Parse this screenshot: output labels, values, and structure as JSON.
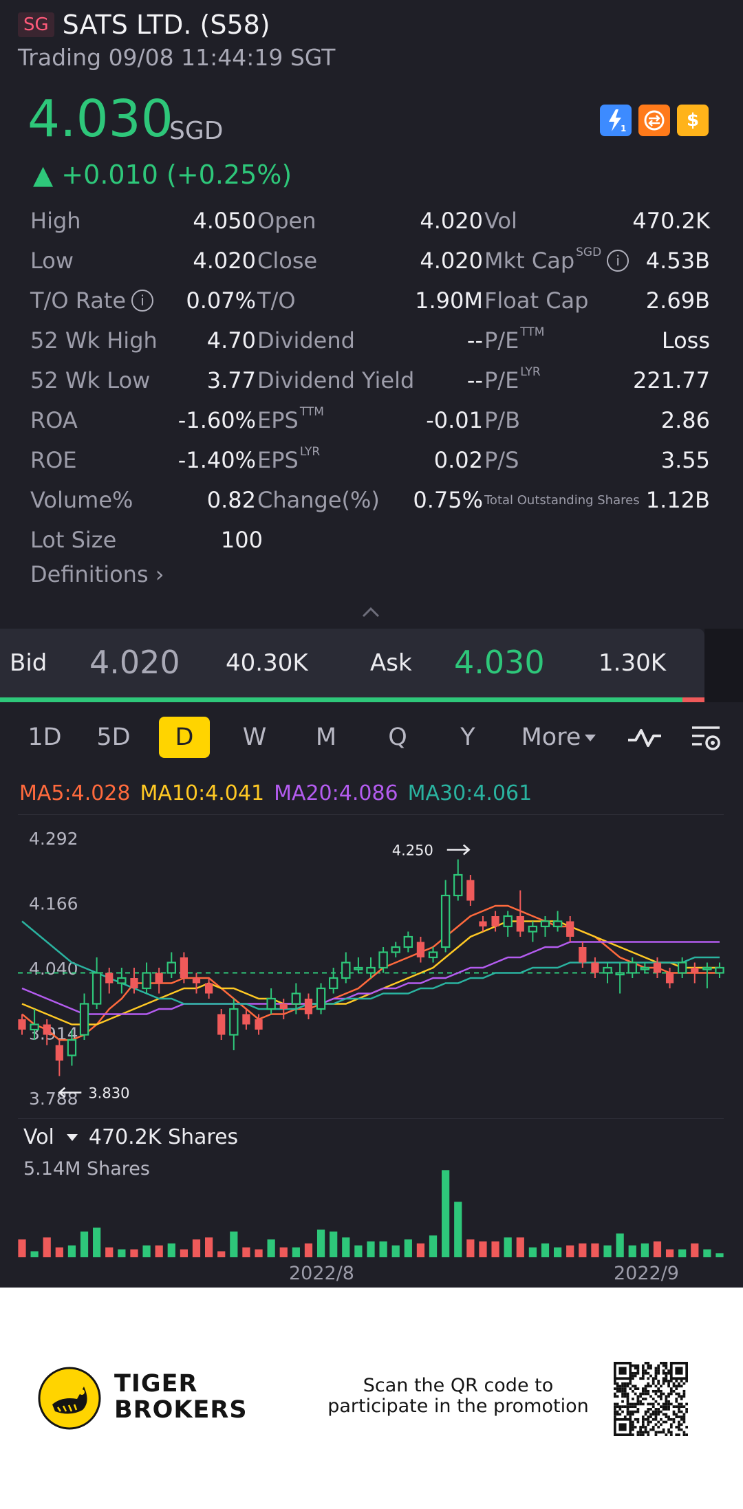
{
  "header": {
    "market": "SG",
    "name": "SATS LTD. (S58)",
    "status": "Trading 09/08 11:44:19 SGT"
  },
  "quote": {
    "price": "4.030",
    "currency": "SGD",
    "change": "▲ +0.010 (+0.25%)",
    "direction": "up",
    "up_color": "#2ec77a",
    "down_color": "#ef5a5a"
  },
  "badges": [
    {
      "icon": "lightning-1-icon",
      "text": "⚡"
    },
    {
      "icon": "swap-icon",
      "text": "⇆"
    },
    {
      "icon": "dollar-icon",
      "text": "$"
    }
  ],
  "stats": {
    "high": {
      "label": "High",
      "value": "4.050"
    },
    "open": {
      "label": "Open",
      "value": "4.020"
    },
    "vol": {
      "label": "Vol",
      "value": "470.2K"
    },
    "low": {
      "label": "Low",
      "value": "4.020"
    },
    "close": {
      "label": "Close",
      "value": "4.020"
    },
    "mktcap": {
      "label": "Mkt Cap",
      "sup": "SGD",
      "value": "4.53B"
    },
    "to_rate": {
      "label": "T/O Rate",
      "value": "0.07%"
    },
    "to": {
      "label": "T/O",
      "value": "1.90M"
    },
    "float_cap": {
      "label": "Float Cap",
      "value": "2.69B"
    },
    "wk52_high": {
      "label": "52 Wk High",
      "value": "4.70"
    },
    "dividend": {
      "label": "Dividend",
      "value": "--"
    },
    "pe_ttm": {
      "label": "P/E",
      "sup": "TTM",
      "value": "Loss"
    },
    "wk52_low": {
      "label": "52 Wk Low",
      "value": "3.77"
    },
    "dividend_yield": {
      "label": "Dividend Yield",
      "value": "--"
    },
    "pe_lyr": {
      "label": "P/E",
      "sup": "LYR",
      "value": "221.77"
    },
    "roa": {
      "label": "ROA",
      "value": "-1.60%"
    },
    "eps_ttm": {
      "label": "EPS",
      "sup": "TTM",
      "value": "-0.01"
    },
    "pb": {
      "label": "P/B",
      "value": "2.86"
    },
    "roe": {
      "label": "ROE",
      "value": "-1.40%"
    },
    "eps_lyr": {
      "label": "EPS",
      "sup": "LYR",
      "value": "0.02"
    },
    "ps": {
      "label": "P/S",
      "value": "3.55"
    },
    "volume_pct": {
      "label": "Volume%",
      "value": "0.82"
    },
    "change_pct": {
      "label": "Change(%)",
      "value": "0.75%"
    },
    "total_shares": {
      "label": "Total Outstanding Shares",
      "value": "1.12B"
    },
    "lot_size": {
      "label": "Lot Size",
      "value": "100"
    }
  },
  "definitions_label": "Definitions ›",
  "bidask": {
    "bid_label": "Bid",
    "bid_price": "4.020",
    "bid_qty": "40.30K",
    "ask_label": "Ask",
    "ask_price": "4.030",
    "ask_qty": "1.30K",
    "bid_ratio": 0.969
  },
  "periods": {
    "items": [
      "1D",
      "5D",
      "D",
      "W",
      "M",
      "Q",
      "Y"
    ],
    "more": "More",
    "active": "D"
  },
  "ma_legend": [
    {
      "text": "MA5:4.028",
      "color": "#ff6a3d"
    },
    {
      "text": "MA10:4.041",
      "color": "#ffc924"
    },
    {
      "text": "MA20:4.086",
      "color": "#b45cf0"
    },
    {
      "text": "MA30:4.061",
      "color": "#2ab3a0"
    }
  ],
  "volume": {
    "label": "Vol",
    "current": "470.2K Shares",
    "max": "5.14M Shares"
  },
  "x_labels": [
    "2022/8",
    "2022/9"
  ],
  "chart_data": {
    "type": "candlestick",
    "y_ticks": [
      "4.292",
      "4.166",
      "4.040",
      "3.914",
      "3.788"
    ],
    "ylim": [
      3.788,
      4.292
    ],
    "current_line": 4.03,
    "high_marker": "4.250",
    "low_marker": "3.830",
    "candles": [
      {
        "o": 3.94,
        "c": 3.92,
        "h": 3.95,
        "l": 3.91,
        "v": 0.9
      },
      {
        "o": 3.92,
        "c": 3.93,
        "h": 3.96,
        "l": 3.9,
        "v": 0.3
      },
      {
        "o": 3.93,
        "c": 3.91,
        "h": 3.94,
        "l": 3.89,
        "v": 1.0
      },
      {
        "o": 3.89,
        "c": 3.86,
        "h": 3.9,
        "l": 3.83,
        "v": 0.5
      },
      {
        "o": 3.87,
        "c": 3.9,
        "h": 3.92,
        "l": 3.85,
        "v": 0.6
      },
      {
        "o": 3.91,
        "c": 3.97,
        "h": 3.99,
        "l": 3.9,
        "v": 1.3
      },
      {
        "o": 3.97,
        "c": 4.03,
        "h": 4.06,
        "l": 3.96,
        "v": 1.5
      },
      {
        "o": 4.03,
        "c": 4.01,
        "h": 4.04,
        "l": 3.99,
        "v": 0.5
      },
      {
        "o": 4.01,
        "c": 4.02,
        "h": 4.04,
        "l": 3.99,
        "v": 0.4
      },
      {
        "o": 4.02,
        "c": 4.0,
        "h": 4.04,
        "l": 3.99,
        "v": 0.4
      },
      {
        "o": 4.0,
        "c": 4.03,
        "h": 4.05,
        "l": 3.99,
        "v": 0.6
      },
      {
        "o": 4.03,
        "c": 4.01,
        "h": 4.04,
        "l": 3.99,
        "v": 0.6
      },
      {
        "o": 4.03,
        "c": 4.05,
        "h": 4.07,
        "l": 4.02,
        "v": 0.7
      },
      {
        "o": 4.06,
        "c": 4.02,
        "h": 4.07,
        "l": 4.01,
        "v": 0.4
      },
      {
        "o": 4.02,
        "c": 4.01,
        "h": 4.03,
        "l": 3.99,
        "v": 0.9
      },
      {
        "o": 4.01,
        "c": 3.99,
        "h": 4.02,
        "l": 3.98,
        "v": 1.0
      },
      {
        "o": 3.95,
        "c": 3.91,
        "h": 3.96,
        "l": 3.9,
        "v": 0.3
      },
      {
        "o": 3.91,
        "c": 3.96,
        "h": 3.98,
        "l": 3.88,
        "v": 1.3
      },
      {
        "o": 3.95,
        "c": 3.93,
        "h": 3.96,
        "l": 3.92,
        "v": 0.5
      },
      {
        "o": 3.94,
        "c": 3.92,
        "h": 3.95,
        "l": 3.91,
        "v": 0.4
      },
      {
        "o": 3.96,
        "c": 3.98,
        "h": 4.0,
        "l": 3.95,
        "v": 0.9
      },
      {
        "o": 3.97,
        "c": 3.96,
        "h": 3.98,
        "l": 3.94,
        "v": 0.5
      },
      {
        "o": 3.97,
        "c": 3.99,
        "h": 4.01,
        "l": 3.95,
        "v": 0.5
      },
      {
        "o": 3.98,
        "c": 3.95,
        "h": 3.99,
        "l": 3.94,
        "v": 0.7
      },
      {
        "o": 3.96,
        "c": 4.0,
        "h": 4.01,
        "l": 3.95,
        "v": 1.4
      },
      {
        "o": 4.0,
        "c": 4.02,
        "h": 4.04,
        "l": 3.99,
        "v": 1.3
      },
      {
        "o": 4.02,
        "c": 4.05,
        "h": 4.07,
        "l": 4.01,
        "v": 1.0
      },
      {
        "o": 4.04,
        "c": 4.04,
        "h": 4.06,
        "l": 4.03,
        "v": 0.6
      },
      {
        "o": 4.03,
        "c": 4.04,
        "h": 4.06,
        "l": 4.02,
        "v": 0.8
      },
      {
        "o": 4.04,
        "c": 4.07,
        "h": 4.08,
        "l": 4.03,
        "v": 0.8
      },
      {
        "o": 4.07,
        "c": 4.08,
        "h": 4.09,
        "l": 4.06,
        "v": 0.6
      },
      {
        "o": 4.08,
        "c": 4.1,
        "h": 4.11,
        "l": 4.07,
        "v": 0.9
      },
      {
        "o": 4.09,
        "c": 4.06,
        "h": 4.1,
        "l": 4.05,
        "v": 0.7
      },
      {
        "o": 4.06,
        "c": 4.07,
        "h": 4.08,
        "l": 4.05,
        "v": 1.1
      },
      {
        "o": 4.08,
        "c": 4.18,
        "h": 4.21,
        "l": 4.07,
        "v": 4.4
      },
      {
        "o": 4.18,
        "c": 4.22,
        "h": 4.25,
        "l": 4.17,
        "v": 2.8
      },
      {
        "o": 4.21,
        "c": 4.17,
        "h": 4.22,
        "l": 4.16,
        "v": 0.9
      },
      {
        "o": 4.13,
        "c": 4.12,
        "h": 4.14,
        "l": 4.11,
        "v": 0.8
      },
      {
        "o": 4.14,
        "c": 4.12,
        "h": 4.15,
        "l": 4.11,
        "v": 0.8
      },
      {
        "o": 4.12,
        "c": 4.14,
        "h": 4.15,
        "l": 4.1,
        "v": 1.0
      },
      {
        "o": 4.14,
        "c": 4.11,
        "h": 4.19,
        "l": 4.1,
        "v": 1.0
      },
      {
        "o": 4.11,
        "c": 4.12,
        "h": 4.13,
        "l": 4.09,
        "v": 0.5
      },
      {
        "o": 4.12,
        "c": 4.13,
        "h": 4.14,
        "l": 4.1,
        "v": 0.7
      },
      {
        "o": 4.12,
        "c": 4.13,
        "h": 4.15,
        "l": 4.11,
        "v": 0.5
      },
      {
        "o": 4.13,
        "c": 4.1,
        "h": 4.14,
        "l": 4.09,
        "v": 0.6
      },
      {
        "o": 4.08,
        "c": 4.05,
        "h": 4.09,
        "l": 4.04,
        "v": 0.7
      },
      {
        "o": 4.05,
        "c": 4.03,
        "h": 4.06,
        "l": 4.02,
        "v": 0.7
      },
      {
        "o": 4.03,
        "c": 4.04,
        "h": 4.05,
        "l": 4.01,
        "v": 0.6
      },
      {
        "o": 4.03,
        "c": 4.03,
        "h": 4.05,
        "l": 3.99,
        "v": 1.2
      },
      {
        "o": 4.03,
        "c": 4.05,
        "h": 4.06,
        "l": 4.02,
        "v": 0.6
      },
      {
        "o": 4.04,
        "c": 4.04,
        "h": 4.05,
        "l": 4.03,
        "v": 0.7
      },
      {
        "o": 4.05,
        "c": 4.03,
        "h": 4.06,
        "l": 4.02,
        "v": 0.8
      },
      {
        "o": 4.03,
        "c": 4.01,
        "h": 4.04,
        "l": 4.0,
        "v": 0.4
      },
      {
        "o": 4.03,
        "c": 4.05,
        "h": 4.06,
        "l": 4.02,
        "v": 0.4
      },
      {
        "o": 4.04,
        "c": 4.03,
        "h": 4.05,
        "l": 4.01,
        "v": 0.7
      },
      {
        "o": 4.04,
        "c": 4.04,
        "h": 4.05,
        "l": 4.0,
        "v": 0.4
      },
      {
        "o": 4.03,
        "c": 4.04,
        "h": 4.05,
        "l": 4.02,
        "v": 0.2
      }
    ],
    "ma5": [
      3.95,
      3.93,
      3.92,
      3.9,
      3.9,
      3.91,
      3.93,
      3.96,
      3.98,
      4.01,
      4.01,
      4.01,
      4.01,
      4.02,
      4.02,
      4.02,
      4.0,
      3.98,
      3.96,
      3.94,
      3.95,
      3.95,
      3.96,
      3.96,
      3.97,
      3.98,
      3.99,
      4.0,
      4.02,
      4.04,
      4.05,
      4.06,
      4.07,
      4.08,
      4.1,
      4.12,
      4.14,
      4.15,
      4.16,
      4.16,
      4.15,
      4.14,
      4.13,
      4.12,
      4.12,
      4.11,
      4.1,
      4.08,
      4.06,
      4.05,
      4.04,
      4.04,
      4.03,
      4.03,
      4.03,
      4.03,
      4.03
    ],
    "ma10": [
      3.97,
      3.96,
      3.95,
      3.94,
      3.93,
      3.93,
      3.93,
      3.94,
      3.95,
      3.96,
      3.97,
      3.98,
      3.99,
      4.0,
      4.0,
      4.01,
      4.0,
      4.0,
      3.99,
      3.98,
      3.98,
      3.97,
      3.97,
      3.97,
      3.97,
      3.97,
      3.97,
      3.98,
      3.99,
      4.0,
      4.01,
      4.02,
      4.03,
      4.04,
      4.06,
      4.08,
      4.1,
      4.11,
      4.12,
      4.13,
      4.13,
      4.13,
      4.13,
      4.13,
      4.12,
      4.11,
      4.1,
      4.09,
      4.08,
      4.07,
      4.06,
      4.05,
      4.05,
      4.04,
      4.04,
      4.04,
      4.04
    ],
    "ma20": [
      4.0,
      3.99,
      3.98,
      3.97,
      3.96,
      3.95,
      3.95,
      3.95,
      3.95,
      3.95,
      3.95,
      3.96,
      3.96,
      3.97,
      3.97,
      3.97,
      3.97,
      3.97,
      3.97,
      3.97,
      3.97,
      3.97,
      3.97,
      3.97,
      3.97,
      3.98,
      3.98,
      3.99,
      3.99,
      4.0,
      4.0,
      4.01,
      4.01,
      4.02,
      4.02,
      4.03,
      4.04,
      4.04,
      4.05,
      4.06,
      4.06,
      4.07,
      4.08,
      4.08,
      4.09,
      4.09,
      4.09,
      4.09,
      4.09,
      4.09,
      4.09,
      4.09,
      4.09,
      4.09,
      4.09,
      4.09,
      4.09
    ],
    "ma30": [
      4.13,
      4.11,
      4.09,
      4.07,
      4.05,
      4.04,
      4.03,
      4.02,
      4.01,
      4.0,
      3.99,
      3.98,
      3.98,
      3.97,
      3.97,
      3.97,
      3.97,
      3.97,
      3.97,
      3.96,
      3.96,
      3.96,
      3.96,
      3.97,
      3.97,
      3.97,
      3.98,
      3.98,
      3.98,
      3.99,
      3.99,
      3.99,
      4.0,
      4.0,
      4.01,
      4.01,
      4.02,
      4.02,
      4.03,
      4.03,
      4.03,
      4.04,
      4.04,
      4.04,
      4.05,
      4.05,
      4.05,
      4.05,
      4.05,
      4.05,
      4.05,
      4.05,
      4.05,
      4.05,
      4.06,
      4.06,
      4.06
    ]
  },
  "promo": {
    "brand_line1": "TIGER",
    "brand_line2": "BROKERS",
    "text": "Scan the QR code to participate in the promotion"
  }
}
